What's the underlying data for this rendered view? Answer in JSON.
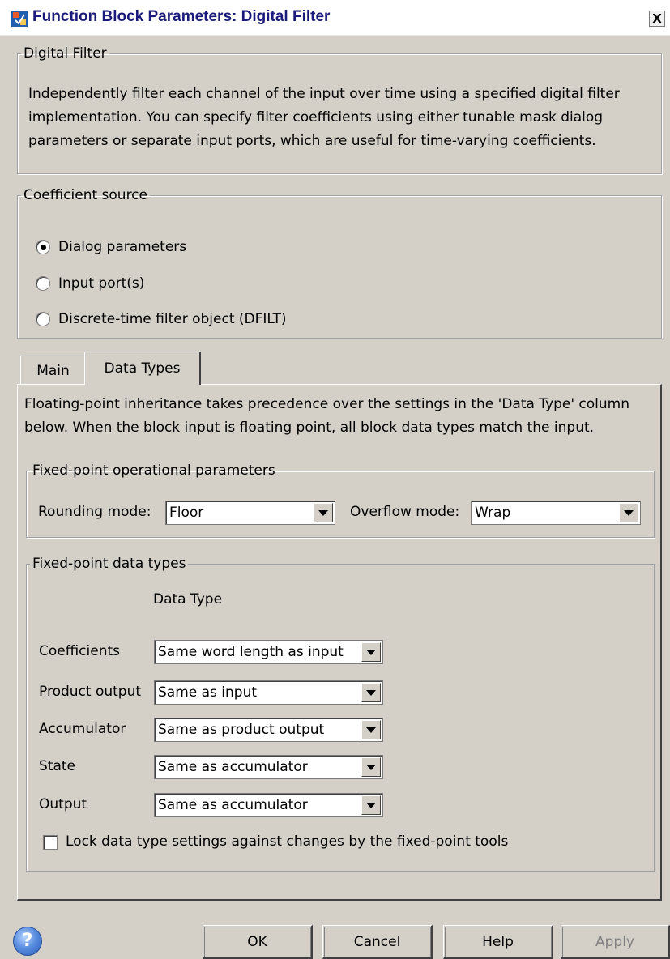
{
  "window": {
    "title": "Function Block Parameters: Digital Filter",
    "close_label": "X"
  },
  "description_group": {
    "legend": "Digital Filter",
    "lines": [
      "Independently filter each channel of the input over time using a specified digital filter",
      "implementation. You can specify filter coefficients using either tunable mask dialog",
      "parameters or separate input ports, which are useful for time-varying coefficients."
    ]
  },
  "coefficient_source": {
    "legend": "Coefficient source",
    "options": [
      {
        "label": "Dialog parameters",
        "checked": true
      },
      {
        "label": "Input port(s)",
        "checked": false
      },
      {
        "label": "Discrete-time filter object (DFILT)",
        "checked": false
      }
    ]
  },
  "tabs": [
    {
      "label": "Main",
      "active": false
    },
    {
      "label": "Data Types",
      "active": true
    }
  ],
  "data_types_tab": {
    "note_lines": [
      "Floating-point inheritance takes precedence over the settings in the 'Data Type' column",
      "below. When the block input is floating point, all block data types match the input."
    ],
    "operational": {
      "legend": "Fixed-point operational parameters",
      "rounding_label": "Rounding mode:",
      "rounding_value": "Floor",
      "overflow_label": "Overflow mode:",
      "overflow_value": "Wrap"
    },
    "data_types": {
      "legend": "Fixed-point data types",
      "column_header": "Data Type",
      "rows": [
        {
          "label": "Coefficients",
          "value": "Same word length as input"
        },
        {
          "label": "Product output",
          "value": "Same as input"
        },
        {
          "label": "Accumulator",
          "value": "Same as product output"
        },
        {
          "label": "State",
          "value": "Same as accumulator"
        },
        {
          "label": "Output",
          "value": "Same as accumulator"
        }
      ],
      "lock_label": "Lock data type settings against changes by the fixed-point tools",
      "lock_checked": false
    }
  },
  "buttons": {
    "ok": "OK",
    "cancel": "Cancel",
    "help": "Help",
    "apply": "Apply"
  },
  "colors": {
    "dialog_bg": "#d4d0c8",
    "title_text": "#1a1a7a",
    "disabled_text": "#808080"
  }
}
